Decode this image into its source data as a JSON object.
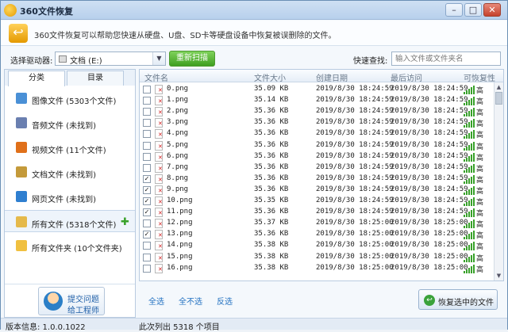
{
  "window": {
    "title": "360文件恢复",
    "min": "–",
    "max": "□",
    "close": "✕"
  },
  "banner": {
    "text": "360文件恢复可以帮助您快速从硬盘、U盘、SD卡等硬盘设备中恢复被误删除的文件。"
  },
  "drivebar": {
    "label": "选择驱动器:",
    "selected": "文档 (E:)",
    "arrow": "▼",
    "rescan": "重新扫描",
    "quick_label": "快速查找:",
    "search_placeholder": "输入文件或文件夹名"
  },
  "tabs": [
    "分类",
    "目录"
  ],
  "categories": [
    {
      "label": "图像文件 (5303个文件)",
      "color": "#4a90d6"
    },
    {
      "label": "音频文件 (未找到)",
      "color": "#6a7fb0"
    },
    {
      "label": "视频文件 (11个文件)",
      "color": "#e0701a"
    },
    {
      "label": "文档文件 (未找到)",
      "color": "#c49a3a"
    },
    {
      "label": "网页文件 (未找到)",
      "color": "#2f7fd0"
    },
    {
      "label": "所有文件 (5318个文件)",
      "color": "#e5b94a"
    },
    {
      "label": "所有文件夹 (10个文件夹)",
      "color": "#f0c040"
    }
  ],
  "help": {
    "line1": "提交问题",
    "line2": "给工程师"
  },
  "table": {
    "columns": [
      "文件名",
      "文件大小",
      "创建日期",
      "最后访问",
      "可恢复性"
    ],
    "rows": [
      {
        "checked": false,
        "name": "0.png",
        "size": "35.09 KB",
        "created": "2019/8/30 18:24:59",
        "accessed": "2019/8/30 18:24:59",
        "rec": "高"
      },
      {
        "checked": false,
        "name": "1.png",
        "size": "35.14 KB",
        "created": "2019/8/30 18:24:59",
        "accessed": "2019/8/30 18:24:59",
        "rec": "高"
      },
      {
        "checked": false,
        "name": "2.png",
        "size": "35.36 KB",
        "created": "2019/8/30 18:24:59",
        "accessed": "2019/8/30 18:24:59",
        "rec": "高"
      },
      {
        "checked": false,
        "name": "3.png",
        "size": "35.36 KB",
        "created": "2019/8/30 18:24:59",
        "accessed": "2019/8/30 18:24:59",
        "rec": "高"
      },
      {
        "checked": false,
        "name": "4.png",
        "size": "35.36 KB",
        "created": "2019/8/30 18:24:59",
        "accessed": "2019/8/30 18:24:59",
        "rec": "高"
      },
      {
        "checked": false,
        "name": "5.png",
        "size": "35.36 KB",
        "created": "2019/8/30 18:24:59",
        "accessed": "2019/8/30 18:24:59",
        "rec": "高"
      },
      {
        "checked": false,
        "name": "6.png",
        "size": "35.36 KB",
        "created": "2019/8/30 18:24:59",
        "accessed": "2019/8/30 18:24:59",
        "rec": "高"
      },
      {
        "checked": false,
        "name": "7.png",
        "size": "35.36 KB",
        "created": "2019/8/30 18:24:59",
        "accessed": "2019/8/30 18:24:59",
        "rec": "高"
      },
      {
        "checked": true,
        "name": "8.png",
        "size": "35.36 KB",
        "created": "2019/8/30 18:24:59",
        "accessed": "2019/8/30 18:24:59",
        "rec": "高"
      },
      {
        "checked": true,
        "name": "9.png",
        "size": "35.36 KB",
        "created": "2019/8/30 18:24:59",
        "accessed": "2019/8/30 18:24:59",
        "rec": "高"
      },
      {
        "checked": true,
        "name": "10.png",
        "size": "35.35 KB",
        "created": "2019/8/30 18:24:59",
        "accessed": "2019/8/30 18:24:59",
        "rec": "高"
      },
      {
        "checked": true,
        "name": "11.png",
        "size": "35.36 KB",
        "created": "2019/8/30 18:24:59",
        "accessed": "2019/8/30 18:24:59",
        "rec": "高"
      },
      {
        "checked": false,
        "name": "12.png",
        "size": "35.37 KB",
        "created": "2019/8/30 18:25:00",
        "accessed": "2019/8/30 18:25:00",
        "rec": "高"
      },
      {
        "checked": true,
        "name": "13.png",
        "size": "35.36 KB",
        "created": "2019/8/30 18:25:00",
        "accessed": "2019/8/30 18:25:00",
        "rec": "高"
      },
      {
        "checked": false,
        "name": "14.png",
        "size": "35.38 KB",
        "created": "2019/8/30 18:25:00",
        "accessed": "2019/8/30 18:25:00",
        "rec": "高"
      },
      {
        "checked": false,
        "name": "15.png",
        "size": "35.38 KB",
        "created": "2019/8/30 18:25:00",
        "accessed": "2019/8/30 18:25:00",
        "rec": "高"
      },
      {
        "checked": false,
        "name": "16.png",
        "size": "35.38 KB",
        "created": "2019/8/30 18:25:00",
        "accessed": "2019/8/30 18:25:00",
        "rec": "高"
      }
    ]
  },
  "actions": {
    "select_all": "全选",
    "select_none": "全不选",
    "invert": "反选",
    "recover": "恢复选中的文件"
  },
  "status": {
    "version": "版本信息: 1.0.0.1022",
    "listed": "此次列出 5318 个项目"
  }
}
